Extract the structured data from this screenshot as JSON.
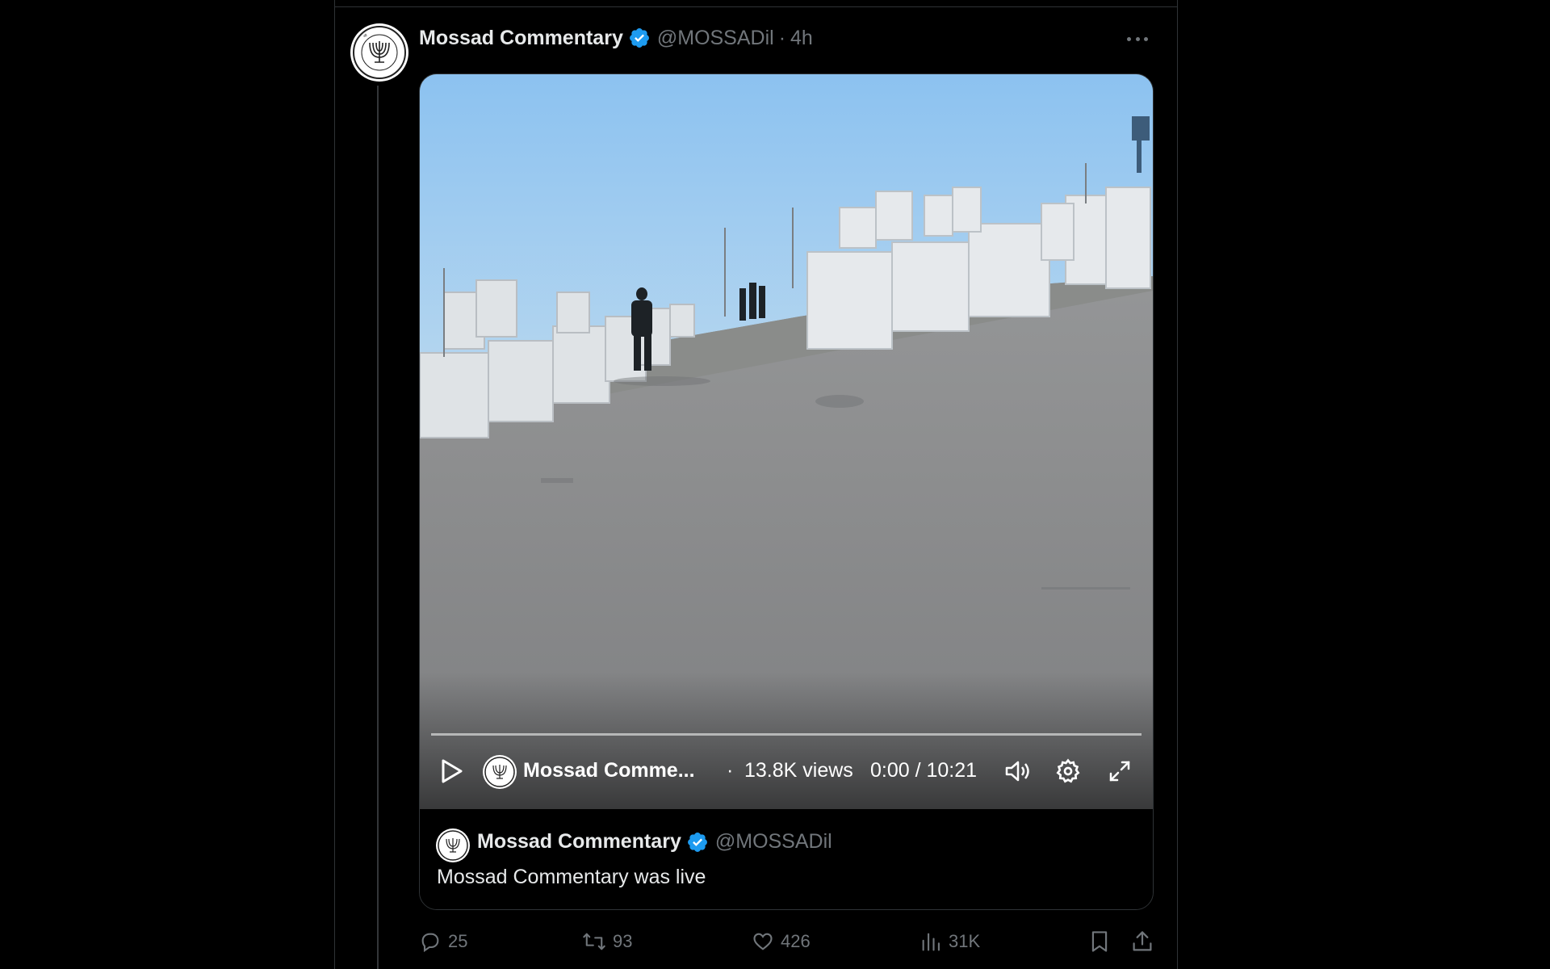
{
  "tweet": {
    "display_name": "Mossad Commentary",
    "handle": "@MOSSADil",
    "separator": "·",
    "time": "4h",
    "verified": true,
    "avatar_icon": "menorah-emblem-icon",
    "more_icon": "more-dots-icon"
  },
  "video": {
    "channel_name": "Mossad Comme...",
    "separator": "·",
    "views": "13.8K views",
    "time": "0:00 / 10:21",
    "progress": 0,
    "icons": [
      "play-icon",
      "volume-icon",
      "settings-icon",
      "fullscreen-icon"
    ]
  },
  "quote": {
    "display_name": "Mossad Commentary",
    "handle": "@MOSSADil",
    "text": "Mossad Commentary was live"
  },
  "actions": {
    "replies": "25",
    "reposts": "93",
    "likes": "426",
    "views": "31K"
  },
  "colors": {
    "background": "#000000",
    "border": "#2f3336",
    "text_primary": "#e7e9ea",
    "text_secondary": "#71767b",
    "verified_blue": "#1d9bf0"
  }
}
